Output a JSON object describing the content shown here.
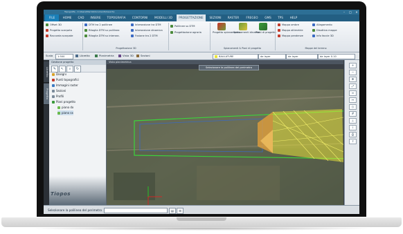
{
  "window": {
    "title": "Topografia - C:\\Users\\Marini\\Documenti\\Cava.frp",
    "min_glyph": "–",
    "max_glyph": "□",
    "close_glyph": "✕"
  },
  "menu": {
    "file_label": "FILE",
    "items": [
      "HOME",
      "CAD",
      "INSERE",
      "TOPOGRAFIA",
      "CONTORNI",
      "MODELLI 3D",
      "PROGETTAZIONE",
      "SEZIONI",
      "RASTER",
      "FREGEO",
      "GMS",
      "TPS",
      "HELP"
    ],
    "active": "PROGETTAZIONE"
  },
  "ribbon": {
    "group1": {
      "items": [
        "Offset 3D",
        "Progetta scarpata",
        "Raccorda scarpate"
      ],
      "title": ""
    },
    "group2": {
      "col1": [
        "DTM tra 2 polilinee",
        "Ritaglia DTM su polilinea",
        "Ritaglia DTM su intersez."
      ],
      "col2": [
        "Intersezione tra DTM",
        "Intersezione dinamica",
        "Fusione tra 2 DTM"
      ],
      "title": "Progettazione 3D"
    },
    "group3": {
      "items": [
        "Polilinee su DTM",
        "Progettazione agraria"
      ],
      "title": ""
    },
    "group4": {
      "big": [
        "Progetto spianamento",
        "Spianamenti dinamici",
        "Piani di progetto"
      ],
      "title": "Spianamenti & Piani di progetto"
    },
    "group5": {
      "col1": [
        "Mappa ombre",
        "Mappa altimetrie",
        "Mappa pendenze"
      ],
      "col2": [
        "Allagamento",
        "Disattiva mappe",
        "Info faccie 3D"
      ],
      "title": "Mappe del terreno"
    }
  },
  "toolbar": {
    "scale_label": "Scala",
    "scale_value": "1:500",
    "libretto": "Libretto",
    "planimetria": "Planimetria",
    "vista3d": "Vista 3D",
    "sezioni": "Sezioni",
    "layer_name": "BAULATURE",
    "color_mode": "da layer",
    "linetype": "da layer",
    "lineweight": "da layer 0.10"
  },
  "left_tabs": [
    "Libretto",
    "Progetto"
  ],
  "panel": {
    "title": "Gestione progetto",
    "tree": [
      "Disegni",
      "Punti topografici",
      "Immagini raster",
      "Sezioni",
      "Profili",
      "Piani progetto",
      "piano dx",
      "piano sx"
    ],
    "brand": "Tiopos"
  },
  "viewport": {
    "tab_label": "Vista planimetrica",
    "prompt": "Selezionare la polilinea del perimetro"
  },
  "status": {
    "message": "Selezionare la polilinea del perimetro"
  },
  "colors": {
    "accent": "#235f83",
    "polyline_green": "#3bd53b",
    "surface_yellow": "#e8e23a",
    "slope_orange": "#e8a23a"
  }
}
